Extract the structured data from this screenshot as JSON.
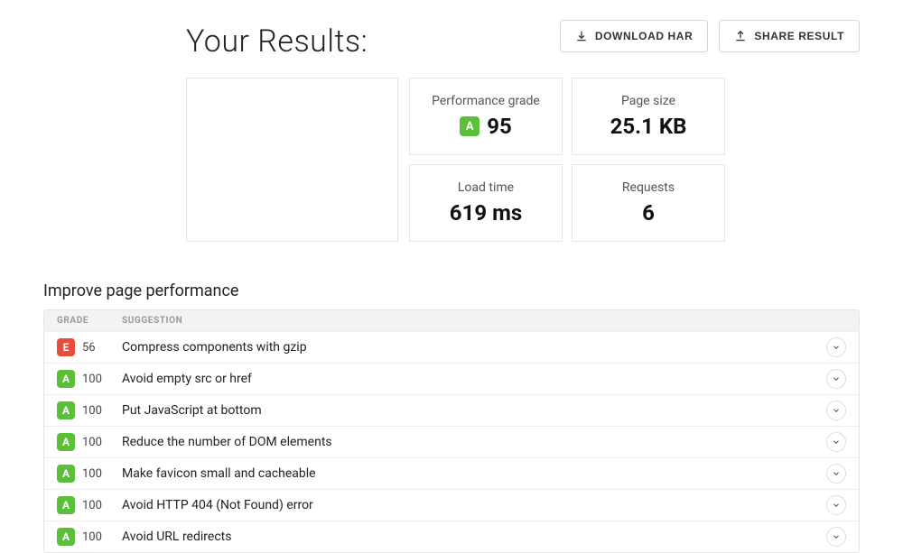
{
  "header": {
    "title": "Your Results:",
    "download_label": "DOWNLOAD HAR",
    "share_label": "SHARE RESULT"
  },
  "metrics": {
    "performance": {
      "label": "Performance grade",
      "grade": "A",
      "value": "95"
    },
    "pagesize": {
      "label": "Page size",
      "value": "25.1 KB"
    },
    "loadtime": {
      "label": "Load time",
      "value": "619 ms"
    },
    "requests": {
      "label": "Requests",
      "value": "6"
    }
  },
  "section": {
    "heading": "Improve page performance",
    "col_grade": "GRADE",
    "col_suggestion": "SUGGESTION"
  },
  "rows": [
    {
      "grade": "E",
      "score": "56",
      "text": "Compress components with gzip"
    },
    {
      "grade": "A",
      "score": "100",
      "text": "Avoid empty src or href"
    },
    {
      "grade": "A",
      "score": "100",
      "text": "Put JavaScript at bottom"
    },
    {
      "grade": "A",
      "score": "100",
      "text": "Reduce the number of DOM elements"
    },
    {
      "grade": "A",
      "score": "100",
      "text": "Make favicon small and cacheable"
    },
    {
      "grade": "A",
      "score": "100",
      "text": "Avoid HTTP 404 (Not Found) error"
    },
    {
      "grade": "A",
      "score": "100",
      "text": "Avoid URL redirects"
    }
  ]
}
